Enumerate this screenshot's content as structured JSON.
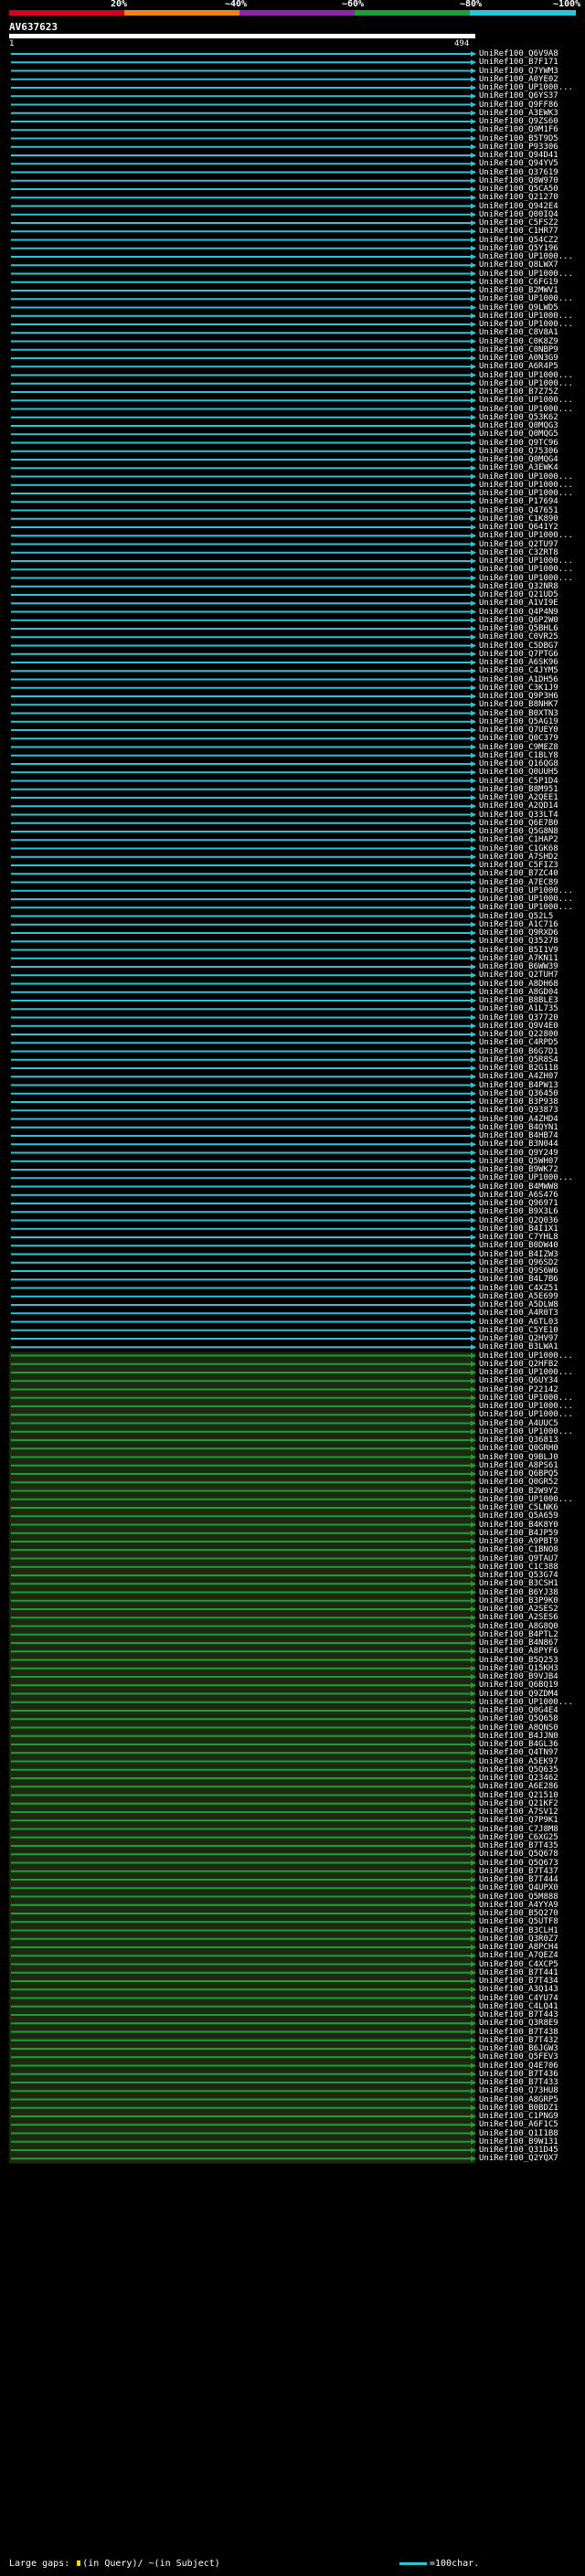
{
  "legend": {
    "ticks": [
      "20%",
      "~40%",
      "~60%",
      "~80%",
      "~100%"
    ],
    "colors": [
      "#d0021b",
      "#f57f17",
      "#8e24aa",
      "#1e9e35",
      "#26c6da"
    ]
  },
  "query": {
    "name": "AV637623",
    "start": "1",
    "end": "494"
  },
  "hits": [
    "UniRef100_Q6V9A8",
    "UniRef100_B7F171",
    "UniRef100_Q7YWM3",
    "UniRef100_A0YE02",
    "UniRef100_UP1000...",
    "UniRef100_Q6YS37",
    "UniRef100_Q9FF86",
    "UniRef100_A3EWK3",
    "UniRef100_Q9ZS60",
    "UniRef100_Q9M1F6",
    "UniRef100_B5T9D5",
    "UniRef100_P93306",
    "UniRef100_Q94D41",
    "UniRef100_Q94YV5",
    "UniRef100_Q37619",
    "UniRef100_Q8W970",
    "UniRef100_Q5CA50",
    "UniRef100_Q21270",
    "UniRef100_Q942E4",
    "UniRef100_Q00IQ4",
    "UniRef100_C5FSZ2",
    "UniRef100_C1HR77",
    "UniRef100_Q54CZ2",
    "UniRef100_Q5Y196",
    "UniRef100_UP1000...",
    "UniRef100_Q8LWX7",
    "UniRef100_UP1000...",
    "UniRef100_C6FG19",
    "UniRef100_B2MWV1",
    "UniRef100_UP1000...",
    "UniRef100_Q9LWD5",
    "UniRef100_UP1000...",
    "UniRef100_UP1000...",
    "UniRef100_C8V8A1",
    "UniRef100_C0K8Z9",
    "UniRef100_C0NBP9",
    "UniRef100_A0N3G9",
    "UniRef100_A6R4P5",
    "UniRef100_UP1000...",
    "UniRef100_UP1000...",
    "UniRef100_B7Z75Z",
    "UniRef100_UP1000...",
    "UniRef100_UP1000...",
    "UniRef100_Q53K62",
    "UniRef100_Q0MQG3",
    "UniRef100_Q0MQG5",
    "UniRef100_Q9TC96",
    "UniRef100_Q75306",
    "UniRef100_Q0MQG4",
    "UniRef100_A3EWK4",
    "UniRef100_UP1000...",
    "UniRef100_UP1000...",
    "UniRef100_UP1000...",
    "UniRef100_P17694",
    "UniRef100_Q47651",
    "UniRef100_C1K890",
    "UniRef100_Q641Y2",
    "UniRef100_UP1000...",
    "UniRef100_Q2TU97",
    "UniRef100_C3ZRT8",
    "UniRef100_UP1000...",
    "UniRef100_UP1000...",
    "UniRef100_UP1000...",
    "UniRef100_Q32NR8",
    "UniRef100_Q21UD5",
    "UniRef100_A1VI9E",
    "UniRef100_Q4P4N9",
    "UniRef100_Q6P2W0",
    "UniRef100_Q5BHL6",
    "UniRef100_C0VR25",
    "UniRef100_C5DBG7",
    "UniRef100_Q7PTG6",
    "UniRef100_A6SK96",
    "UniRef100_C4JYM5",
    "UniRef100_A1DH56",
    "UniRef100_C3K1J9",
    "UniRef100_Q9P3H6",
    "UniRef100_B8NHK7",
    "UniRef100_B0XTN3",
    "UniRef100_Q5AG19",
    "UniRef100_Q7UEY0",
    "UniRef100_Q0C379",
    "UniRef100_C9MEZ8",
    "UniRef100_C1BLY8",
    "UniRef100_Q16QG8",
    "UniRef100_Q0UUH5",
    "UniRef100_C5P1D4",
    "UniRef100_B8M951",
    "UniRef100_A2QEE1",
    "UniRef100_A2QD14",
    "UniRef100_Q33LT4",
    "UniRef100_Q6E7B0",
    "UniRef100_Q5G8N8",
    "UniRef100_C1HAP2",
    "UniRef100_C1GK68",
    "UniRef100_A7SHD2",
    "UniRef100_C5FIZ3",
    "UniRef100_B7ZC40",
    "UniRef100_A7EC89",
    "UniRef100_UP1000...",
    "UniRef100_UP1000...",
    "UniRef100_UP1000...",
    "UniRef100_Q52L5",
    "UniRef100_A1C716",
    "UniRef100_Q9RXD6",
    "UniRef100_Q35278",
    "UniRef100_B5I1V9",
    "UniRef100_A7KN11",
    "UniRef100_B6WW39",
    "UniRef100_Q2TUH7",
    "UniRef100_A8DH68",
    "UniRef100_A8GD04",
    "UniRef100_B8BLE3",
    "UniRef100_A1L735",
    "UniRef100_Q37720",
    "UniRef100_Q9V4E0",
    "UniRef100_Q22800",
    "UniRef100_C4RPD5",
    "UniRef100_B6G7D1",
    "UniRef100_Q5R8S4",
    "UniRef100_B2G118",
    "UniRef100_A4ZH07",
    "UniRef100_B4PW13",
    "UniRef100_Q36450",
    "UniRef100_B3P938",
    "UniRef100_Q93873",
    "UniRef100_A4ZHD4",
    "UniRef100_B4QYN1",
    "UniRef100_B4HB74",
    "UniRef100_B3N044",
    "UniRef100_Q9Y249",
    "UniRef100_Q5WH07",
    "UniRef100_B9WK72",
    "UniRef100_UP1000...",
    "UniRef100_B4MWW8",
    "UniRef100_A6S476",
    "UniRef100_Q96971",
    "UniRef100_B9X3L6",
    "UniRef100_Q2Q036",
    "UniRef100_B4I1X1",
    "UniRef100_C7YHL8",
    "UniRef100_B0DW40",
    "UniRef100_B4IZW3",
    "UniRef100_Q96SD2",
    "UniRef100_Q9S6W6",
    "UniRef100_B4L7B6",
    "UniRef100_C4XZ51",
    "UniRef100_A5E699",
    "UniRef100_A5DLW8",
    "UniRef100_A4R0T3",
    "UniRef100_A6TL03",
    "UniRef100_C5YE10",
    "UniRef100_Q2HV97",
    "UniRef100_B3LWA1",
    "UniRef100_UP1000...",
    "UniRef100_Q2HFB2",
    "UniRef100_UP1000...",
    "UniRef100_Q6UY34",
    "UniRef100_P22142",
    "UniRef100_UP1000...",
    "UniRef100_UP1000...",
    "UniRef100_UP1000...",
    "UniRef100_A4UUC5",
    "UniRef100_UP1000...",
    "UniRef100_Q36813",
    "UniRef100_Q0GRH0",
    "UniRef100_Q9BLJ0",
    "UniRef100_A8PS61",
    "UniRef100_Q6BPQ5",
    "UniRef100_Q0GR52",
    "UniRef100_B2W9Y2",
    "UniRef100_UP1000...",
    "UniRef100_C5LNK6",
    "UniRef100_Q5A659",
    "UniRef100_B4K8Y0",
    "UniRef100_B4JP59",
    "UniRef100_A9PBT9",
    "UniRef100_C1BNO8",
    "UniRef100_Q9TAU7",
    "UniRef100_C1C388",
    "UniRef100_Q53G74",
    "UniRef100_B3CSH1",
    "UniRef100_B6YJ38",
    "UniRef100_B3P9K0",
    "UniRef100_A2SES2",
    "UniRef100_A2SES6",
    "UniRef100_A8G8Q0",
    "UniRef100_B4PTL2",
    "UniRef100_B4N867",
    "UniRef100_A8PYF6",
    "UniRef100_B5Q253",
    "UniRef100_Q15KH3",
    "UniRef100_B9VJB4",
    "UniRef100_Q6BQ19",
    "UniRef100_Q9ZDM4",
    "UniRef100_UP1000...",
    "UniRef100_Q0G4E4",
    "UniRef100_Q5Q658",
    "UniRef100_A8QNS0",
    "UniRef100_B4JJN0",
    "UniRef100_B4GL36",
    "UniRef100_Q4TN97",
    "UniRef100_A5EK97",
    "UniRef100_Q5Q635",
    "UniRef100_Q23462",
    "UniRef100_A6E286",
    "UniRef100_Q21510",
    "UniRef100_Q21KF2",
    "UniRef100_A7SV12",
    "UniRef100_Q7P9K1",
    "UniRef100_C7J8M8",
    "UniRef100_C6XG25",
    "UniRef100_B7T435",
    "UniRef100_Q5Q678",
    "UniRef100_Q5Q673",
    "UniRef100_B7T437",
    "UniRef100_B7T444",
    "UniRef100_Q4UPX0",
    "UniRef100_Q5M888",
    "UniRef100_A4YYA9",
    "UniRef100_B5Q270",
    "UniRef100_Q5UTF8",
    "UniRef100_B3CLH1",
    "UniRef100_Q3R0Z7",
    "UniRef100_A8PCH4",
    "UniRef100_A7QEZ4",
    "UniRef100_C4XCP5",
    "UniRef100_B7T441",
    "UniRef100_B7T434",
    "UniRef100_A3Q143",
    "UniRef100_C4YU74",
    "UniRef100_C4LQ41",
    "UniRef100_B7T443",
    "UniRef100_Q3R8E9",
    "UniRef100_B7T438",
    "UniRef100_B7T432",
    "UniRef100_B6JGW3",
    "UniRef100_Q5FEV3",
    "UniRef100_Q4E706",
    "UniRef100_B7T436",
    "UniRef100_B7T433",
    "UniRef100_Q73HU8",
    "UniRef100_A8GRP5",
    "UniRef100_B0BDZ1",
    "UniRef100_C1PNG9",
    "UniRef100_A6F1C5",
    "UniRef100_Q1I1B8",
    "UniRef100_B9W131",
    "UniRef100_Q31D45",
    "UniRef100_Q2YQX7"
  ],
  "footer": {
    "text": "Large gaps:",
    "in_query": "(in Query)/",
    "in_subject": "~(in Subject)",
    "scale_label": "=100char."
  }
}
